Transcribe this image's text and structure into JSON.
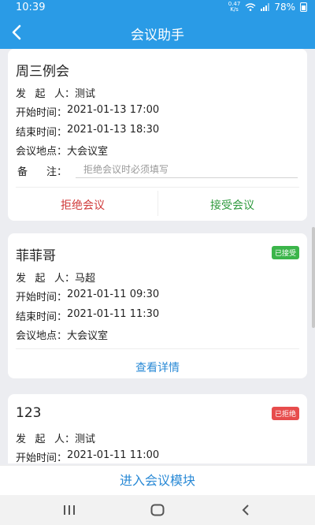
{
  "status_bar": {
    "time": "10:39",
    "net_speed_value": "0.47",
    "net_speed_unit": "K/s",
    "battery": "78%"
  },
  "app_bar": {
    "title": "会议助手",
    "back_icon": "chevron-left-icon"
  },
  "meetings": [
    {
      "title": "周三例会",
      "initiator_label": [
        "发",
        "起",
        "人"
      ],
      "initiator": "测试",
      "start_label": "开始时间：",
      "start": "2021-01-13 17:00",
      "end_label": "结束时间：",
      "end": "2021-01-13 18:30",
      "location_label": "会议地点：",
      "location": "大会议室",
      "note_label": [
        "备",
        "注"
      ],
      "note_placeholder": "拒绝会议时必须填写",
      "reject_label": "拒绝会议",
      "accept_label": "接受会议"
    },
    {
      "title": "菲菲哥",
      "status": "已接受",
      "initiator": "马超",
      "start": "2021-01-11 09:30",
      "end": "2021-01-11 11:30",
      "location": "大会议室",
      "details_label": "查看详情"
    },
    {
      "title": "123",
      "status": "已拒绝",
      "initiator": "测试",
      "start": "2021-01-11 11:00"
    }
  ],
  "colon": "：",
  "bottom_button": "进入会议模块",
  "colors": {
    "primary": "#2a9be6",
    "link": "#2a8ad6",
    "reject": "#d03a3a",
    "accept": "#2f9a3e",
    "accepted_badge": "#3bb54a",
    "rejected_badge": "#e74c4c"
  }
}
